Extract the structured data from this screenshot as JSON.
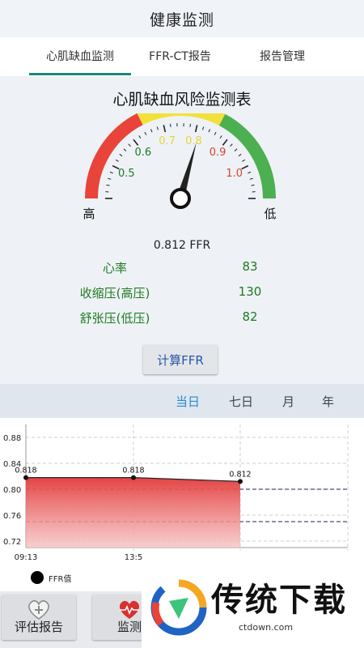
{
  "header": {
    "title": "健康监测"
  },
  "tabs": [
    {
      "label": "心肌缺血监测",
      "active": true
    },
    {
      "label": "FFR-CT报告",
      "active": false
    },
    {
      "label": "报告管理",
      "active": false
    }
  ],
  "gauge": {
    "title": "心肌缺血风险监测表",
    "ticks": [
      "0.5",
      "0.6",
      "0.7",
      "0.8",
      "0.9",
      "1.0"
    ],
    "left_label": "高",
    "right_label": "低",
    "value": 0.812,
    "value_text": "0.812 FFR",
    "colors": {
      "red": "#e8443a",
      "yellow": "#f2e13a",
      "green": "#4caf50"
    }
  },
  "stats": [
    {
      "label": "心率",
      "value": "83"
    },
    {
      "label": "收缩压(高压)",
      "value": "130"
    },
    {
      "label": "舒张压(低压)",
      "value": "82"
    }
  ],
  "calc_button": "计算FFR",
  "periods": [
    {
      "label": "当日",
      "active": true
    },
    {
      "label": "七日",
      "active": false
    },
    {
      "label": "月",
      "active": false
    },
    {
      "label": "年",
      "active": false
    }
  ],
  "chart_data": {
    "type": "area",
    "x": [
      "09:13",
      "13:5",
      ""
    ],
    "values": [
      0.818,
      0.818,
      0.812
    ],
    "data_labels": [
      "0.818",
      "0.818",
      "0.812"
    ],
    "yticks": [
      "0.72",
      "0.76",
      "0.80",
      "0.84",
      "0.88"
    ],
    "ylim": [
      0.71,
      0.9
    ],
    "reference_lines": [
      0.8,
      0.75
    ],
    "legend": "FFR值",
    "grid": true
  },
  "bottom_buttons": [
    {
      "label": "评估报告"
    },
    {
      "label": "监测"
    }
  ],
  "watermark": {
    "text": "传统下载",
    "url": "ctdown.com"
  }
}
